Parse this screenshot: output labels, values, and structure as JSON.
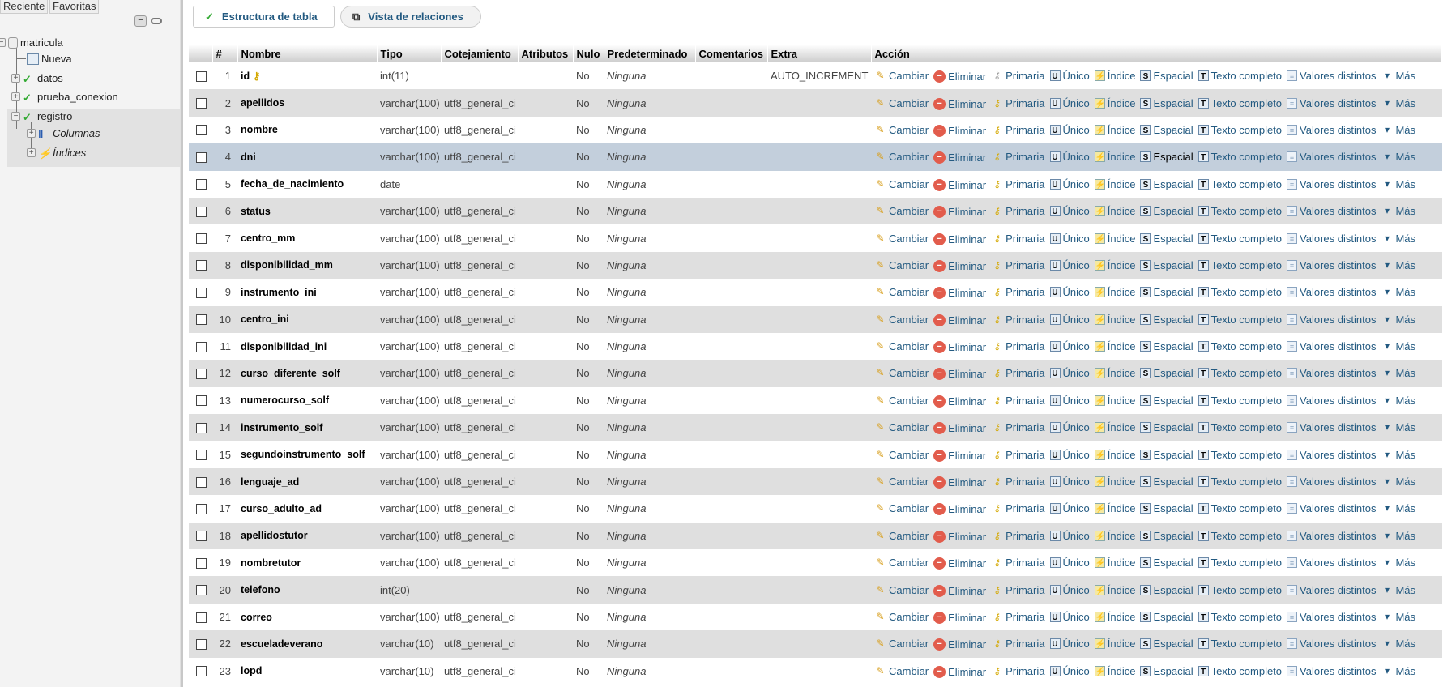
{
  "sidebar": {
    "tabs": [
      "Reciente",
      "Favoritas"
    ],
    "tree": {
      "db": "matricula",
      "new": "Nueva",
      "tables": [
        "datos",
        "prueba_conexion",
        "registro"
      ],
      "sub": [
        "Columnas",
        "Índices"
      ]
    }
  },
  "topbar": {
    "structure": "Estructura de tabla",
    "relations": "Vista de relaciones"
  },
  "table": {
    "headers": [
      "",
      "#",
      "Nombre",
      "Tipo",
      "Cotejamiento",
      "Atributos",
      "Nulo",
      "Predeterminado",
      "Comentarios",
      "Extra",
      "Acción"
    ],
    "actions": [
      "Cambiar",
      "Eliminar",
      "Primaria",
      "Único",
      "Índice",
      "Espacial",
      "Texto completo",
      "Valores distintos",
      "Más"
    ],
    "hover_row": 4,
    "rows": [
      {
        "n": "1",
        "name": "id",
        "type": "int(11)",
        "coll": "",
        "null": "No",
        "def": "Ninguna",
        "extra": "AUTO_INCREMENT",
        "primary": true
      },
      {
        "n": "2",
        "name": "apellidos",
        "type": "varchar(100)",
        "coll": "utf8_general_ci",
        "null": "No",
        "def": "Ninguna",
        "extra": ""
      },
      {
        "n": "3",
        "name": "nombre",
        "type": "varchar(100)",
        "coll": "utf8_general_ci",
        "null": "No",
        "def": "Ninguna",
        "extra": ""
      },
      {
        "n": "4",
        "name": "dni",
        "type": "varchar(100)",
        "coll": "utf8_general_ci",
        "null": "No",
        "def": "Ninguna",
        "extra": ""
      },
      {
        "n": "5",
        "name": "fecha_de_nacimiento",
        "type": "date",
        "coll": "",
        "null": "No",
        "def": "Ninguna",
        "extra": ""
      },
      {
        "n": "6",
        "name": "status",
        "type": "varchar(100)",
        "coll": "utf8_general_ci",
        "null": "No",
        "def": "Ninguna",
        "extra": ""
      },
      {
        "n": "7",
        "name": "centro_mm",
        "type": "varchar(100)",
        "coll": "utf8_general_ci",
        "null": "No",
        "def": "Ninguna",
        "extra": ""
      },
      {
        "n": "8",
        "name": "disponibilidad_mm",
        "type": "varchar(100)",
        "coll": "utf8_general_ci",
        "null": "No",
        "def": "Ninguna",
        "extra": ""
      },
      {
        "n": "9",
        "name": "instrumento_ini",
        "type": "varchar(100)",
        "coll": "utf8_general_ci",
        "null": "No",
        "def": "Ninguna",
        "extra": ""
      },
      {
        "n": "10",
        "name": "centro_ini",
        "type": "varchar(100)",
        "coll": "utf8_general_ci",
        "null": "No",
        "def": "Ninguna",
        "extra": ""
      },
      {
        "n": "11",
        "name": "disponibilidad_ini",
        "type": "varchar(100)",
        "coll": "utf8_general_ci",
        "null": "No",
        "def": "Ninguna",
        "extra": ""
      },
      {
        "n": "12",
        "name": "curso_diferente_solf",
        "type": "varchar(100)",
        "coll": "utf8_general_ci",
        "null": "No",
        "def": "Ninguna",
        "extra": ""
      },
      {
        "n": "13",
        "name": "numerocurso_solf",
        "type": "varchar(100)",
        "coll": "utf8_general_ci",
        "null": "No",
        "def": "Ninguna",
        "extra": ""
      },
      {
        "n": "14",
        "name": "instrumento_solf",
        "type": "varchar(100)",
        "coll": "utf8_general_ci",
        "null": "No",
        "def": "Ninguna",
        "extra": ""
      },
      {
        "n": "15",
        "name": "segundoinstrumento_solf",
        "type": "varchar(100)",
        "coll": "utf8_general_ci",
        "null": "No",
        "def": "Ninguna",
        "extra": ""
      },
      {
        "n": "16",
        "name": "lenguaje_ad",
        "type": "varchar(100)",
        "coll": "utf8_general_ci",
        "null": "No",
        "def": "Ninguna",
        "extra": ""
      },
      {
        "n": "17",
        "name": "curso_adulto_ad",
        "type": "varchar(100)",
        "coll": "utf8_general_ci",
        "null": "No",
        "def": "Ninguna",
        "extra": ""
      },
      {
        "n": "18",
        "name": "apellidostutor",
        "type": "varchar(100)",
        "coll": "utf8_general_ci",
        "null": "No",
        "def": "Ninguna",
        "extra": ""
      },
      {
        "n": "19",
        "name": "nombretutor",
        "type": "varchar(100)",
        "coll": "utf8_general_ci",
        "null": "No",
        "def": "Ninguna",
        "extra": ""
      },
      {
        "n": "20",
        "name": "telefono",
        "type": "int(20)",
        "coll": "",
        "null": "No",
        "def": "Ninguna",
        "extra": ""
      },
      {
        "n": "21",
        "name": "correo",
        "type": "varchar(100)",
        "coll": "utf8_general_ci",
        "null": "No",
        "def": "Ninguna",
        "extra": ""
      },
      {
        "n": "22",
        "name": "escueladeverano",
        "type": "varchar(10)",
        "coll": "utf8_general_ci",
        "null": "No",
        "def": "Ninguna",
        "extra": ""
      },
      {
        "n": "23",
        "name": "lopd",
        "type": "varchar(10)",
        "coll": "utf8_general_ci",
        "null": "No",
        "def": "Ninguna",
        "extra": ""
      }
    ]
  },
  "colors": {
    "link": "#235a81",
    "row_even": "#dfdfdf",
    "row_hover": "#c3cfdc"
  }
}
